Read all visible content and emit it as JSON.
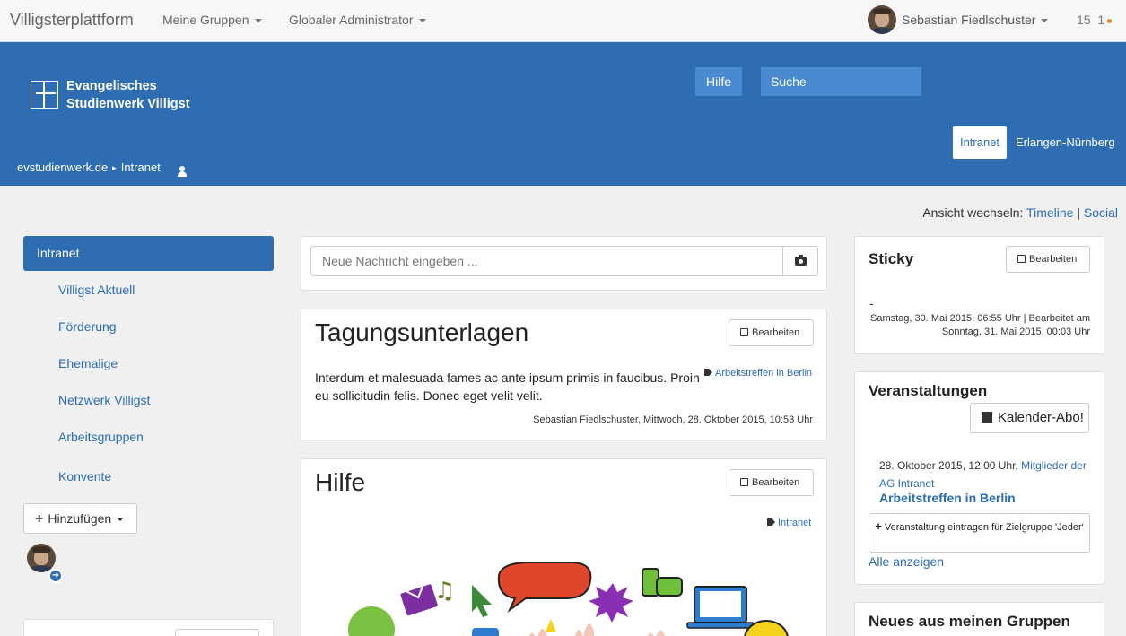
{
  "topnav": {
    "brand": "Villigsterplattform",
    "menu": [
      "Meine Gruppen",
      "Globaler Administrator"
    ],
    "user_name": "Sebastian Fiedlschuster",
    "count_a": "15",
    "count_b": "1"
  },
  "header": {
    "logo_line1": "Evangelisches",
    "logo_line2": "Studienwerk Villigst",
    "help_label": "Hilfe",
    "search_placeholder": "Suche",
    "tab_active": "Intranet",
    "tab_other": "Erlangen-Nürnberg",
    "breadcrumb": [
      "evstudienwerk.de",
      "Intranet"
    ]
  },
  "view_switch": {
    "label": "Ansicht wechseln:",
    "timeline": "Timeline",
    "separator": "|",
    "social": "Social"
  },
  "sidebar": {
    "active": "Intranet",
    "items": [
      "Villigst Aktuell",
      "Förderung",
      "Ehemalige",
      "Netzwerk Villigst",
      "Arbeitsgruppen",
      "Konvente"
    ],
    "add_label": "Hinzufügen"
  },
  "compose": {
    "placeholder": "Neue Nachricht eingeben ..."
  },
  "posts": [
    {
      "title": "Tagungsunterlagen",
      "edit_label": "Bearbeiten",
      "tag": "Arbeitstreffen in Berlin",
      "body": "Interdum et malesuada fames ac ante ipsum primis in faucibus. Proin eu sollicitudin felis. Donec eget velit velit.",
      "meta": "Sebastian Fiedlschuster, Mittwoch, 28. Oktober 2015, 10:53 Uhr"
    },
    {
      "title": "Hilfe",
      "edit_label": "Bearbeiten",
      "tag": "Intranet"
    }
  ],
  "sticky": {
    "title": "Sticky",
    "edit_label": "Bearbeiten",
    "dash": "-",
    "meta": "Samstag, 30. Mai 2015, 06:55 Uhr | Bearbeitet am Sonntag, 31. Mai 2015, 00:03 Uhr"
  },
  "events": {
    "title": "Veranstaltungen",
    "calendar_label": "Kalender-Abo!",
    "date": "28. Oktober 2015, 12:00 Uhr,",
    "group_link": "Mitglieder der AG Intranet",
    "event_title": "Arbeitstreffen in Berlin",
    "register_label": "Veranstaltung eintragen für Zielgruppe 'Jeder'",
    "all_label": "Alle anzeigen"
  },
  "news": {
    "title": "Neues aus meinen Gruppen"
  },
  "colors": {
    "header_blue": "#2f6db3",
    "link_blue": "#2a6cb3"
  }
}
